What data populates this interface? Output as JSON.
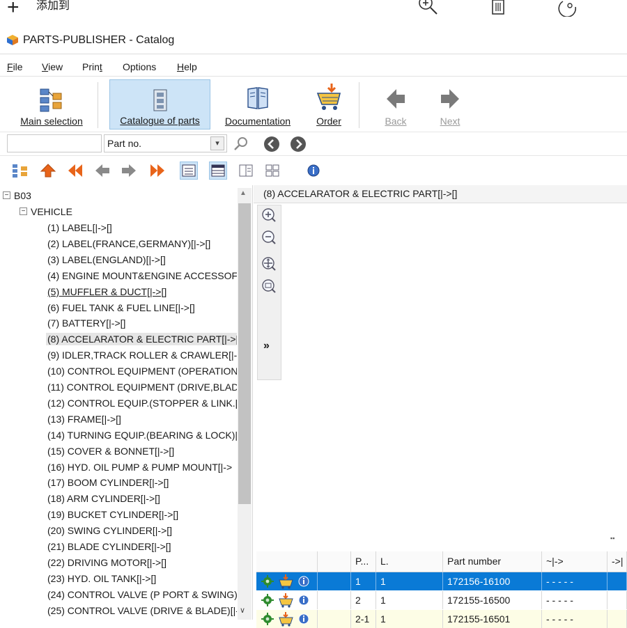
{
  "viewer_strip": {
    "add_label": "添加到",
    "icons": [
      "zoom-in-icon",
      "delete-icon",
      "rotate-icon"
    ]
  },
  "window": {
    "title": "PARTS-PUBLISHER - Catalog"
  },
  "menu": [
    {
      "id": "file",
      "u": "F",
      "rest": "ile"
    },
    {
      "id": "view",
      "u": "V",
      "rest": "iew"
    },
    {
      "id": "print",
      "pre": "Prin",
      "u": "t"
    },
    {
      "id": "options",
      "text": "Options"
    },
    {
      "id": "help",
      "u": "H",
      "rest": "elp"
    }
  ],
  "toolbar": {
    "main_selection": "Main selection",
    "catalogue_of_parts": "Catalogue of parts",
    "documentation": "Documentation",
    "order": "Order",
    "back": "Back",
    "next": "Next"
  },
  "search": {
    "value": "",
    "select_value": "Part no."
  },
  "tree": {
    "root": "B03",
    "group": "VEHICLE",
    "items": [
      "(1) LABEL[|->[]",
      "(2) LABEL(FRANCE,GERMANY)[|->[]",
      "(3) LABEL(ENGLAND)[|->[]",
      "(4) ENGINE MOUNT&ENGINE ACCESSOF",
      "(5) MUFFLER & DUCT[|->[]",
      "(6) FUEL TANK & FUEL LINE[|->[]",
      "(7) BATTERY[|->[]",
      "(8) ACCELARATOR & ELECTRIC PART[|->[]",
      "(9) IDLER,TRACK ROLLER & CRAWLER[|->",
      "(10) CONTROL EQUIPMENT (OPERATION",
      "(11) CONTROL EQUIPMENT (DRIVE,BLAD",
      "(12) CONTROL EQUIP.(STOPPER & LINK.[",
      "(13) FRAME[|->[]",
      "(14) TURNING EQUIP.(BEARING & LOCK)|",
      "(15) COVER & BONNET[|->[]",
      "(16) HYD. OIL PUMP & PUMP MOUNT[|->",
      "(17) BOOM CYLINDER[|->[]",
      "(18) ARM CYLINDER[|->[]",
      "(19) BUCKET CYLINDER[|->[]",
      "(20) SWING CYLINDER[|->[]",
      "(21) BLADE CYLINDER[|->[]",
      "(22) DRIVING MOTOR[|->[]",
      "(23) HYD. OIL TANK[|->[]",
      "(24) CONTROL VALVE (P PORT & SWING)",
      "(25) CONTROL VALVE (DRIVE & BLADE)[|-"
    ],
    "selected_index": 7,
    "underlined_index": 4
  },
  "detail": {
    "title": "(8) ACCELARATOR & ELECTRIC PART[|->[]",
    "expand_label": "»",
    "resize_mark": "▪▪"
  },
  "parts_table": {
    "headers": [
      "",
      "",
      "P...",
      "L.",
      "Part number",
      "~|->",
      "->|"
    ],
    "rows": [
      {
        "pos": "1",
        "level": "1",
        "part_number": "172156-16100",
        "from": "- - - - -",
        "selected": true
      },
      {
        "pos": "2",
        "level": "1",
        "part_number": "172155-16500",
        "from": "- - - - -",
        "selected": false
      },
      {
        "pos": "2-1",
        "level": "1",
        "part_number": "172155-16501",
        "from": "- - - - -",
        "selected": false
      }
    ]
  },
  "colors": {
    "selection_blue": "#0a7ad6",
    "toolbar_active": "#cde4f7",
    "nav_arrow_orange": "#e8641a",
    "gear_green": "#2e8b2e"
  }
}
